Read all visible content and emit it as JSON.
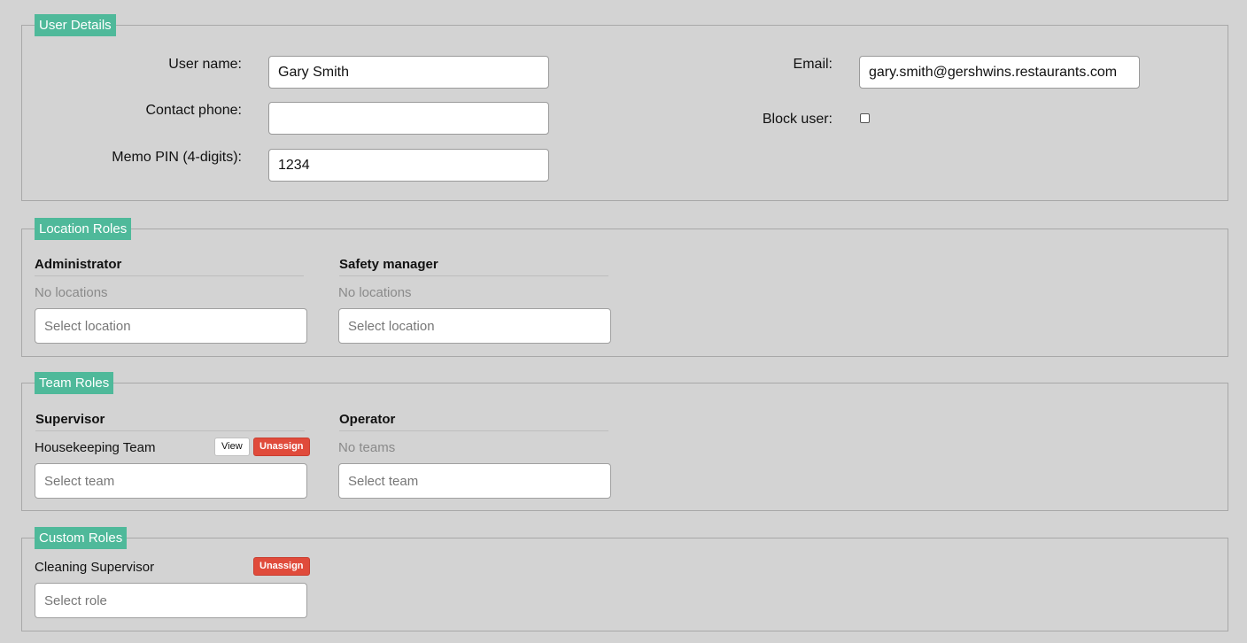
{
  "user_details": {
    "legend": "User Details",
    "user_name": {
      "label": "User name:",
      "value": "Gary Smith"
    },
    "contact_phone": {
      "label": "Contact phone:",
      "value": ""
    },
    "memo_pin": {
      "label": "Memo PIN (4-digits):",
      "value": "1234"
    },
    "email": {
      "label": "Email:",
      "value": "gary.smith@gershwins.restaurants.com"
    },
    "block_user": {
      "label": "Block user:",
      "checked": false
    }
  },
  "location_roles": {
    "legend": "Location Roles",
    "columns": [
      {
        "heading": "Administrator",
        "empty_text": "No locations",
        "placeholder": "Select location"
      },
      {
        "heading": "Safety manager",
        "empty_text": "No locations",
        "placeholder": "Select location"
      }
    ]
  },
  "team_roles": {
    "legend": "Team Roles",
    "supervisor": {
      "heading": "Supervisor",
      "items": [
        {
          "name": "Housekeeping Team",
          "view_label": "View",
          "unassign_label": "Unassign"
        }
      ],
      "placeholder": "Select team"
    },
    "operator": {
      "heading": "Operator",
      "empty_text": "No teams",
      "placeholder": "Select team"
    }
  },
  "custom_roles": {
    "legend": "Custom Roles",
    "items": [
      {
        "name": "Cleaning Supervisor",
        "unassign_label": "Unassign"
      }
    ],
    "placeholder": "Select role"
  },
  "colors": {
    "background": "#d3d3d3",
    "legend": "#4fb99a",
    "danger": "#e04b3b"
  }
}
